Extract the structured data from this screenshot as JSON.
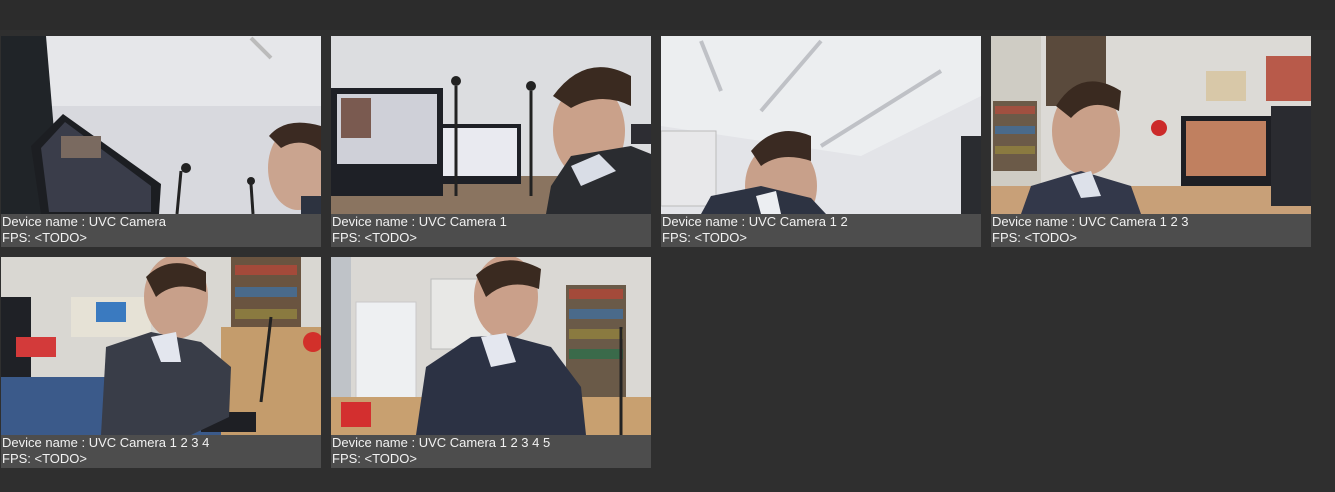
{
  "window": {
    "background_color": "#2f2f2f",
    "label_bar_color": "#4d4d4d",
    "label_text_color": "#f2f2f2"
  },
  "cameras": [
    {
      "device_label": "Device name : UVC Camera",
      "fps_label": "FPS: <TODO>"
    },
    {
      "device_label": "Device name : UVC Camera 1",
      "fps_label": "FPS: <TODO>"
    },
    {
      "device_label": "Device name : UVC Camera 1 2",
      "fps_label": "FPS: <TODO>"
    },
    {
      "device_label": "Device name : UVC Camera 1 2 3",
      "fps_label": "FPS: <TODO>"
    },
    {
      "device_label": "Device name : UVC Camera 1 2 3 4",
      "fps_label": "FPS: <TODO>"
    },
    {
      "device_label": "Device name : UVC Camera 1 2 3 4 5",
      "fps_label": "FPS: <TODO>"
    }
  ]
}
